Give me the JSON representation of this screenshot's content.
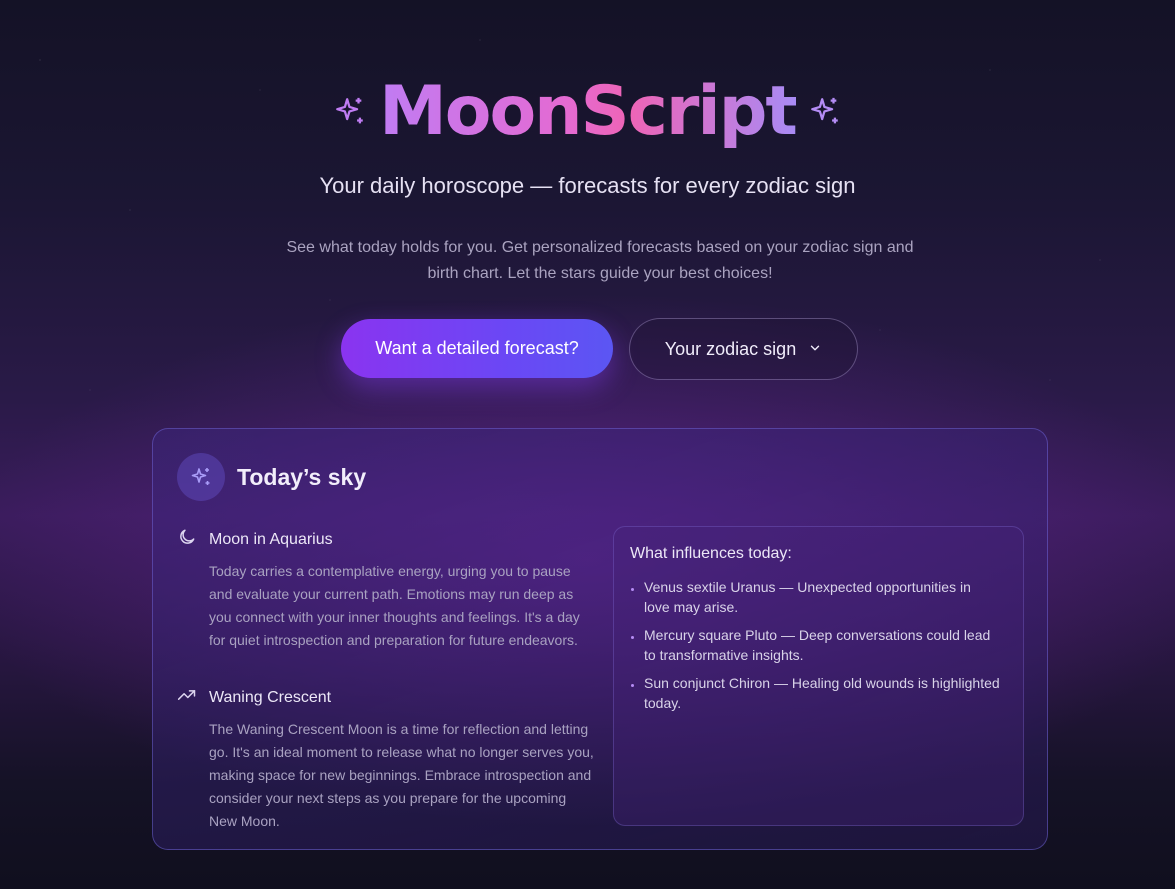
{
  "brand": {
    "name": "MoonScript"
  },
  "hero": {
    "tagline": "Your daily horoscope — forecasts for every zodiac sign",
    "description": "See what today holds for you. Get personalized forecasts based on your zodiac sign and birth chart. Let the stars guide your best choices!",
    "primary_button": "Want a detailed forecast?",
    "secondary_button": "Your zodiac sign"
  },
  "card": {
    "title": "Today’s sky",
    "entries": [
      {
        "icon": "moon-icon",
        "title": "Moon in Aquarius",
        "body": "Today carries a contemplative energy, urging you to pause and evaluate your current path. Emotions may run deep as you connect with your inner thoughts and feelings. It's a day for quiet introspection and preparation for future endeavors."
      },
      {
        "icon": "trending-up-icon",
        "title": "Waning Crescent",
        "body": "The Waning Crescent Moon is a time for reflection and letting go. It's an ideal moment to release what no longer serves you, making space for new beginnings. Embrace introspection and consider your next steps as you prepare for the upcoming New Moon."
      }
    ],
    "influences": {
      "title": "What influences today:",
      "items": [
        "Venus sextile Uranus — Unexpected opportunities in love may arise.",
        "Mercury square Pluto — Deep conversations could lead to transformative insights.",
        "Sun conjunct Chiron — Healing old wounds is highlighted today."
      ]
    }
  },
  "colors": {
    "accent_purple": "#8a34f0",
    "accent_indigo": "#5b56f3",
    "title_gradient_pink": "#e46ad2",
    "title_gradient_violet": "#c07cf3"
  }
}
